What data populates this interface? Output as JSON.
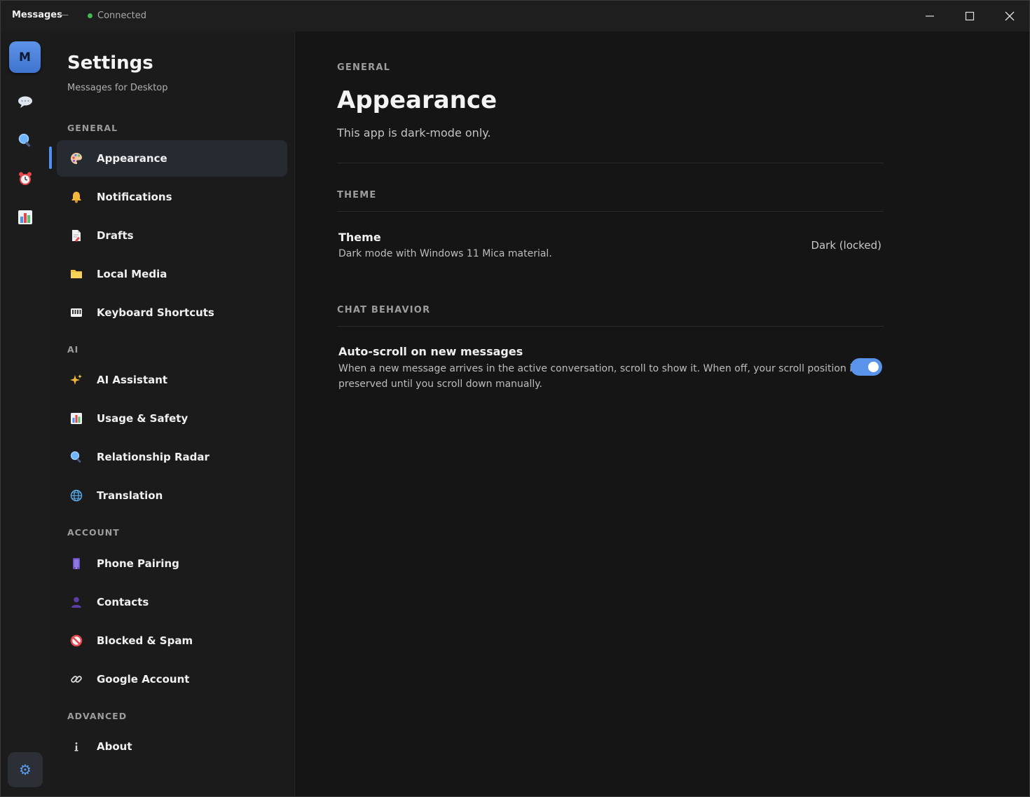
{
  "window": {
    "app_title": "Messages",
    "title_separator": "—",
    "connection_status": "Connected",
    "status_color": "#3fb950",
    "controls": [
      "minimize",
      "maximize",
      "close"
    ]
  },
  "rail": {
    "avatar_letter": "M",
    "items": [
      {
        "name": "chats",
        "icon": "speech-bubble-icon"
      },
      {
        "name": "search",
        "icon": "magnifier-icon"
      },
      {
        "name": "reminders",
        "icon": "alarm-clock-icon"
      },
      {
        "name": "stats",
        "icon": "bar-chart-icon"
      }
    ],
    "settings_icon": "gear-icon"
  },
  "nav": {
    "title": "Settings",
    "subtitle": "Messages for Desktop",
    "sections": {
      "general": "GENERAL",
      "ai": "AI",
      "account": "ACCOUNT",
      "advanced": "ADVANCED"
    },
    "items": {
      "appearance": "Appearance",
      "notifications": "Notifications",
      "drafts": "Drafts",
      "local_media": "Local Media",
      "keyboard_shortcuts": "Keyboard Shortcuts",
      "ai_assistant": "AI Assistant",
      "usage_safety": "Usage & Safety",
      "relationship_radar": "Relationship Radar",
      "translation": "Translation",
      "phone_pairing": "Phone Pairing",
      "contacts": "Contacts",
      "blocked_spam": "Blocked & Spam",
      "google_account": "Google Account",
      "about": "About"
    },
    "active_item": "Appearance",
    "accent_color": "#4f8ff0"
  },
  "main": {
    "breadcrumb": "GENERAL",
    "title": "Appearance",
    "description": "This app is dark-mode only.",
    "theme_section": "THEME",
    "theme": {
      "title": "Theme",
      "description": "Dark mode with Windows 11 Mica material.",
      "value": "Dark (locked)"
    },
    "chat_section": "CHAT BEHAVIOR",
    "autoscroll": {
      "title": "Auto-scroll on new messages",
      "description_line1": "When a new message arrives in the active conversation, scroll to show it. When off, your scroll position is",
      "description_line2": "preserved until you scroll down manually.",
      "enabled": true
    }
  }
}
